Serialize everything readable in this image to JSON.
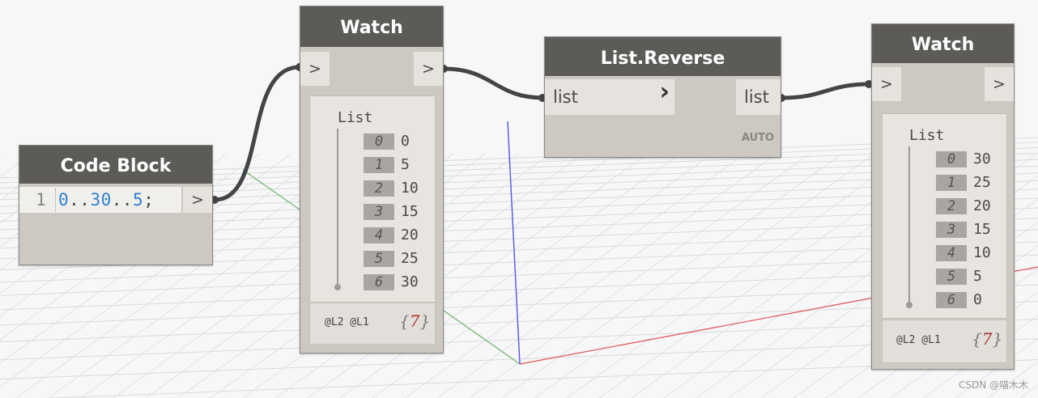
{
  "code_block": {
    "title": "Code Block",
    "line_number": "1",
    "code_tokens": [
      {
        "text": "0",
        "color": "#2f7fd0"
      },
      {
        "text": "..",
        "color": "#444444"
      },
      {
        "text": "30",
        "color": "#2f7fd0"
      },
      {
        "text": "..",
        "color": "#444444"
      },
      {
        "text": "5",
        "color": "#2f7fd0"
      },
      {
        "text": ";",
        "color": "#444444"
      }
    ],
    "output_port": ">"
  },
  "watch1": {
    "title": "Watch",
    "input_port": ">",
    "output_port": ">",
    "list_label": "List",
    "items": [
      {
        "index": "0",
        "value": "0"
      },
      {
        "index": "1",
        "value": "5"
      },
      {
        "index": "2",
        "value": "10"
      },
      {
        "index": "3",
        "value": "15"
      },
      {
        "index": "4",
        "value": "20"
      },
      {
        "index": "5",
        "value": "25"
      },
      {
        "index": "6",
        "value": "30"
      }
    ],
    "levels": "@L2 @L1",
    "count_open": "{",
    "count": "7",
    "count_close": "}"
  },
  "list_reverse": {
    "title": "List.Reverse",
    "input_label": "list",
    "input_arrow": "›",
    "output_label": "list",
    "lacing": "AUTO"
  },
  "watch2": {
    "title": "Watch",
    "input_port": ">",
    "output_port": ">",
    "list_label": "List",
    "items": [
      {
        "index": "0",
        "value": "30"
      },
      {
        "index": "1",
        "value": "25"
      },
      {
        "index": "2",
        "value": "20"
      },
      {
        "index": "3",
        "value": "15"
      },
      {
        "index": "4",
        "value": "10"
      },
      {
        "index": "5",
        "value": "5"
      },
      {
        "index": "6",
        "value": "0"
      }
    ],
    "levels": "@L2 @L1",
    "count_open": "{",
    "count": "7",
    "count_close": "}"
  },
  "watermark": "CSDN @喵木木",
  "colors": {
    "node_title_bg": "#5d5b58",
    "node_body": "#cdc9c2",
    "wire": "#444444",
    "axis_x": "#e05050",
    "axis_y": "#6bb36b",
    "axis_z": "#5555e0",
    "code_number": "#2f7fd0"
  }
}
